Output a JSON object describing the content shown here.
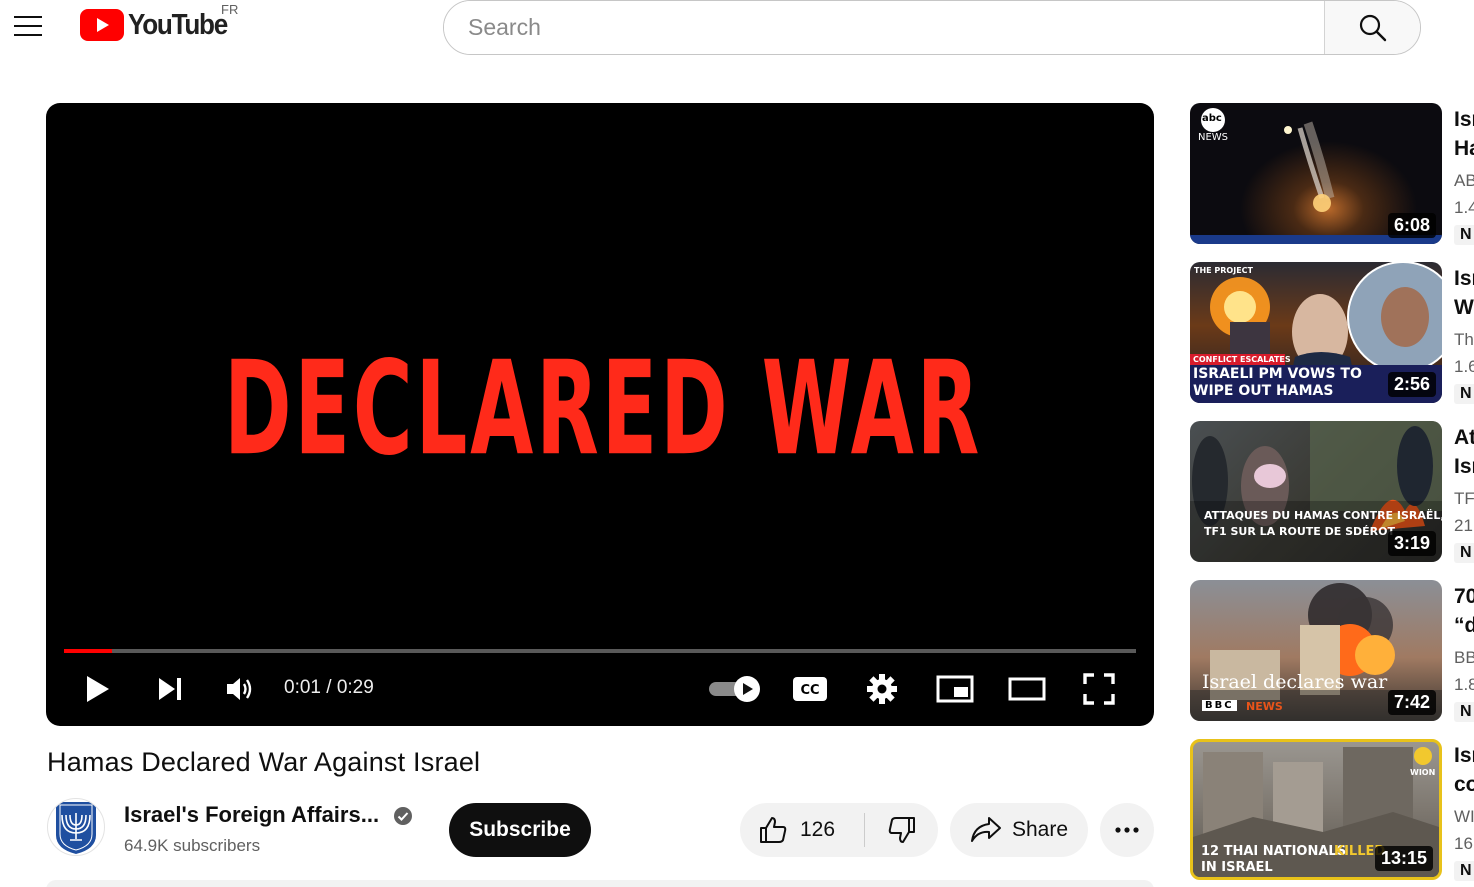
{
  "header": {
    "logo_text": "YouTube",
    "country_code": "FR",
    "search_placeholder": "Search"
  },
  "player": {
    "overlay_text": "DECLARED WAR",
    "current_time": "0:01",
    "duration": "0:29",
    "time_display": "0:01 / 0:29",
    "progress_fraction": 0.045,
    "autoplay_on": true,
    "colors": {
      "progress": "#ff0000",
      "headline": "#ff2a1a"
    }
  },
  "video": {
    "title": "Hamas Declared War Against Israel",
    "channel_name": "Israel's Foreign Affairs...",
    "subscribers": "64.9K subscribers",
    "subscribe_label": "Subscribe",
    "like_count": "126",
    "share_label": "Share"
  },
  "recommendations": [
    {
      "title": "Isr\nHa",
      "channel": "AB",
      "meta": "1.4",
      "badge": "N",
      "duration": "6:08",
      "thumb_logo": "abc",
      "thumb_logo_sub": "NEWS"
    },
    {
      "title": "Isr\nWi",
      "channel": "Th",
      "meta": "1.6",
      "badge": "N",
      "duration": "2:56",
      "thumb_brand": "THE PROJECT",
      "thumb_tag": "CONFLICT ESCALATES",
      "thumb_caption_1": "ISRAELI PM VOWS TO",
      "thumb_caption_2": "WIPE OUT HAMAS"
    },
    {
      "title": "At\nIsr",
      "channel": "TF",
      "meta": "21",
      "badge": "N",
      "duration": "3:19",
      "thumb_caption_1": "ATTAQUES DU HAMAS CONTRE ISRAËL,",
      "thumb_caption_2": "TF1 SUR LA ROUTE DE SDÉROT"
    },
    {
      "title": "70\n“d",
      "channel": "BB",
      "meta": "1.8",
      "badge": "N",
      "duration": "7:42",
      "thumb_caption_1": "Israel declares war",
      "thumb_brand": "BBC",
      "thumb_brand_sub": "NEWS"
    },
    {
      "title": "Isr\nco",
      "channel": "WI",
      "meta": "16",
      "badge": "N",
      "duration": "13:15",
      "thumb_caption_1": "12 THAI NATIONALS",
      "thumb_caption_highlight": "KILLED",
      "thumb_caption_2": "IN ISRAEL",
      "thumb_brand": "WION"
    }
  ]
}
